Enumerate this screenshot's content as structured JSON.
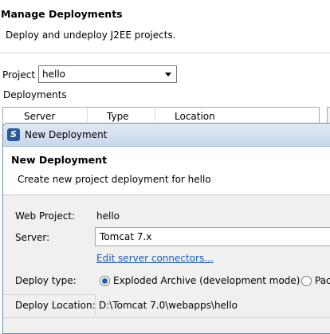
{
  "background": {
    "title": "Manage Deployments",
    "description": "Deploy and undeploy J2EE projects.",
    "project_label": "Project",
    "project_value": "hello",
    "deployments_label": "Deployments",
    "table_columns": [
      "Server",
      "Type",
      "Location"
    ]
  },
  "dialog": {
    "window_title": "New Deployment",
    "heading": "New Deployment",
    "subheading": "Create new project deployment for hello",
    "web_project_label": "Web Project:",
    "web_project_value": "hello",
    "server_label": "Server:",
    "server_value": "Tomcat  7.x",
    "edit_link": "Edit server connectors...",
    "deploy_type_label": "Deploy type:",
    "deploy_type_options": [
      {
        "label": "Exploded Archive (development mode)",
        "selected": true
      },
      {
        "label": "Pac",
        "selected": false
      }
    ],
    "deploy_location_label": "Deploy Location:",
    "deploy_location_value": "D:\\Tomcat 7.0\\webapps\\hello"
  },
  "colors": {
    "link": "#1a5bb5",
    "titlebar": "#c7d8ec",
    "radio_selected": "#1f5fb0"
  },
  "icons": [
    "app-icon",
    "dropdown-arrow-icon"
  ]
}
